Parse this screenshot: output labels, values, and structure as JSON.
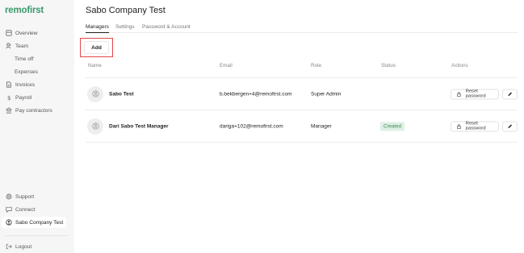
{
  "brand": {
    "logo_text": "remofirst",
    "color": "#3a9a6b"
  },
  "sidebar": {
    "items": [
      {
        "label": "Overview",
        "icon": "overview-icon"
      },
      {
        "label": "Team",
        "icon": "team-icon"
      },
      {
        "label": "Time off"
      },
      {
        "label": "Expenses"
      },
      {
        "label": "Invoices",
        "icon": "invoice-icon"
      },
      {
        "label": "Payroll",
        "icon": "dollar-icon"
      },
      {
        "label": "Pay contractors",
        "icon": "bank-icon"
      }
    ],
    "bottom": [
      {
        "label": "Support",
        "icon": "support-icon"
      },
      {
        "label": "Connect",
        "icon": "chat-icon"
      },
      {
        "label": "Sabo Company Test",
        "icon": "company-icon",
        "active": true
      },
      {
        "label": "Logout",
        "icon": "logout-icon"
      }
    ]
  },
  "main": {
    "title": "Sabo Company Test",
    "tabs": [
      {
        "label": "Managers",
        "active": true
      },
      {
        "label": "Settings"
      },
      {
        "label": "Password & Account"
      }
    ],
    "add_label": "Add",
    "columns": [
      "Name",
      "Email",
      "Role",
      "Status",
      "Actions"
    ],
    "rows": [
      {
        "name": "Sabo Test",
        "email": "b.bekbergen+4@remofirst.com",
        "role": "Super Admin",
        "status": "",
        "reset_label": "Reset password"
      },
      {
        "name": "Dari Sabo Test Manager",
        "email": "dariga+102@remofirst.com",
        "role": "Manager",
        "status": "Created",
        "reset_label": "Reset password"
      }
    ]
  },
  "colors": {
    "accent": "#3a9a6b",
    "status_created_bg": "#dff0e4",
    "status_created_text": "#3c8a57",
    "highlight": "#e34848"
  }
}
